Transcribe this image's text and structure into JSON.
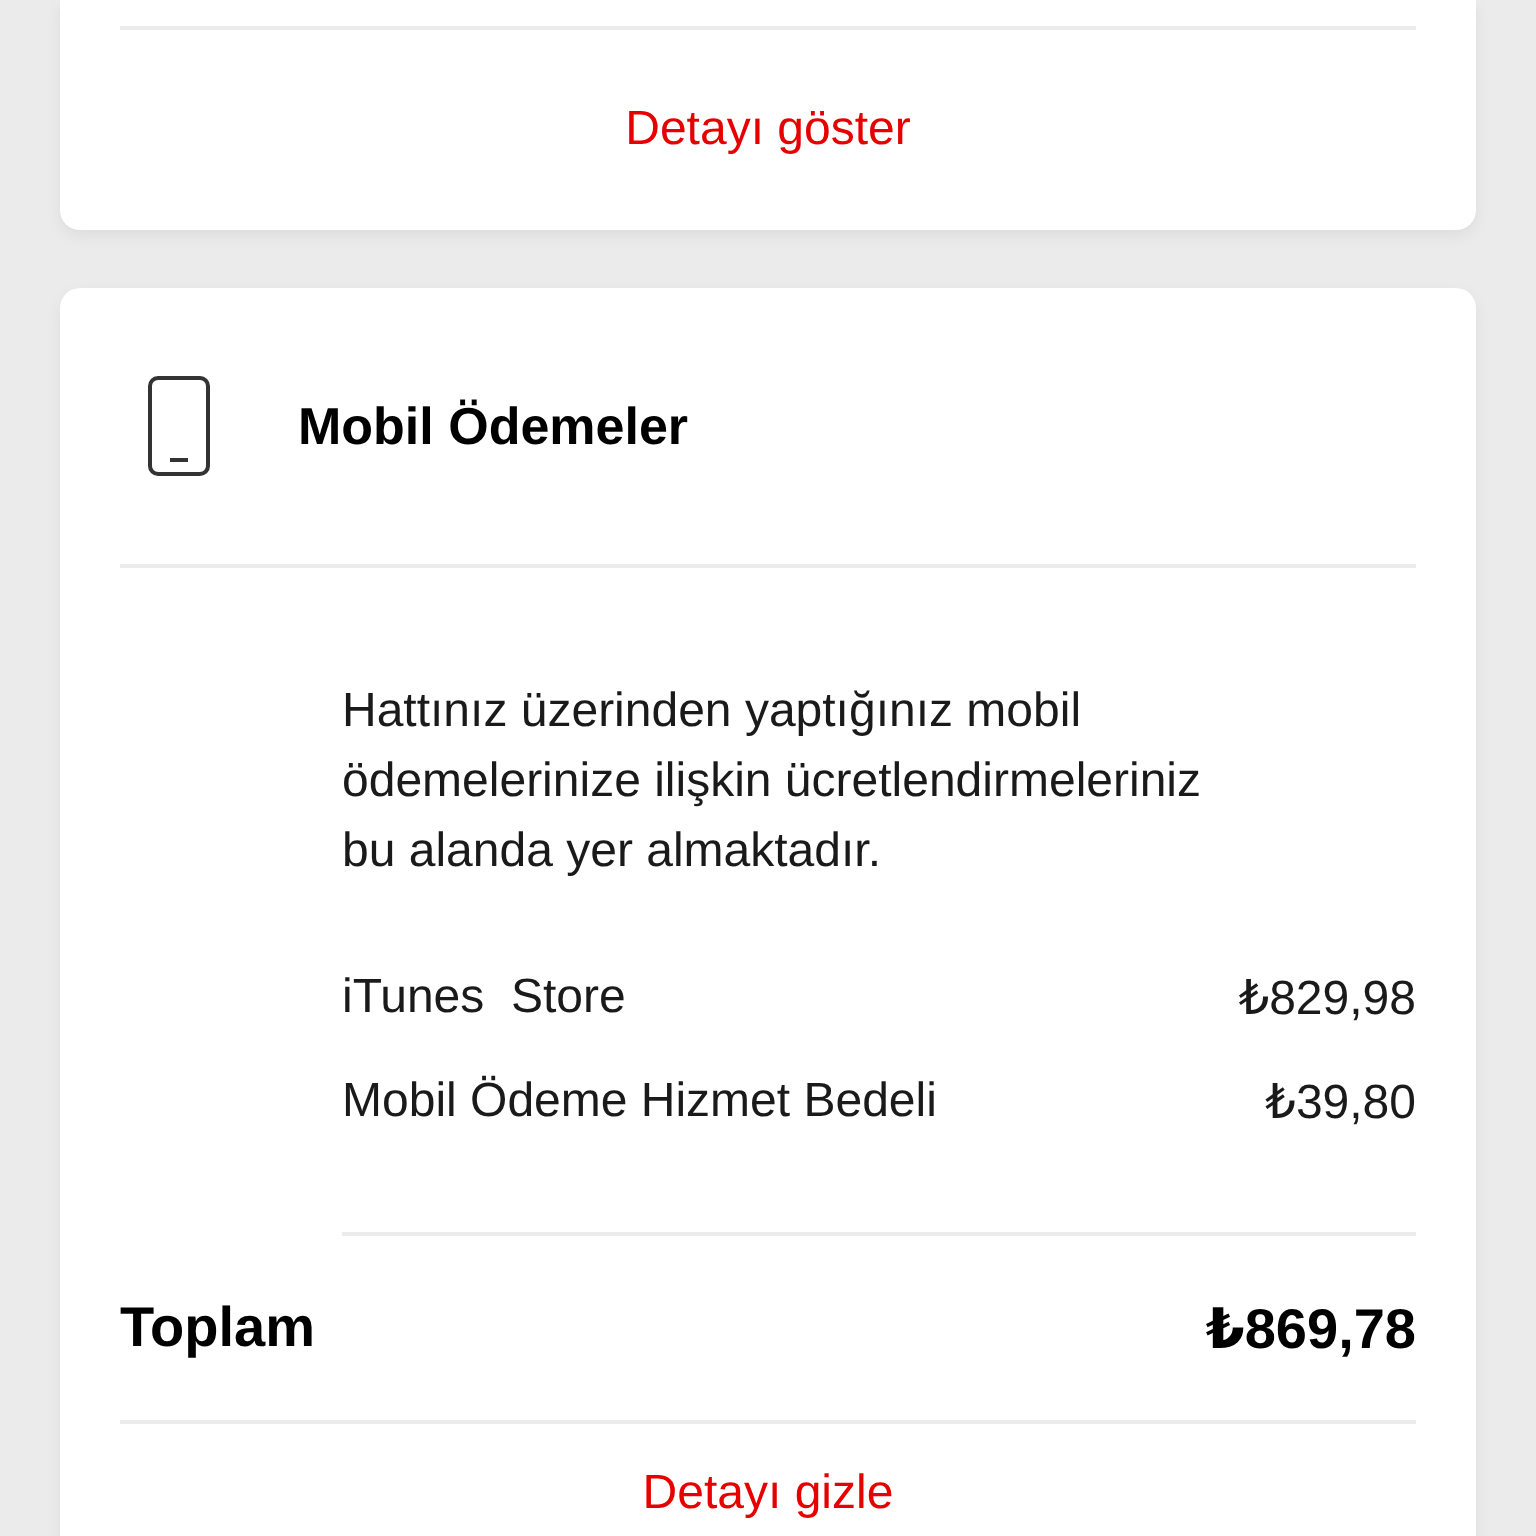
{
  "summary_card": {
    "link": "Detayı göster"
  },
  "section": {
    "title": "Mobil Ödemeler",
    "description": "Hattınız üzerinden yaptığınız mobil ödemelerinize ilişkin ücretlendirmeleriniz bu alanda yer almaktadır.",
    "items": [
      {
        "label": "iTunes  Store",
        "amount": "₺829,98"
      },
      {
        "label": "Mobil Ödeme Hizmet Bedeli",
        "amount": "₺39,80"
      }
    ],
    "total": {
      "label": "Toplam",
      "amount": "₺869,78"
    },
    "link": "Detayı gizle"
  }
}
